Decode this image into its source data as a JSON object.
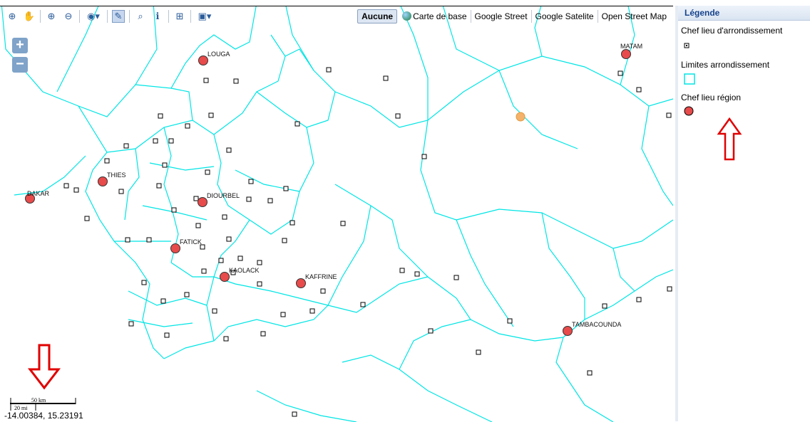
{
  "toolbar": {
    "tools": [
      {
        "icon": "zoom-extent-icon",
        "glyph": "⊕"
      },
      {
        "icon": "pan-hand-icon",
        "glyph": "✋"
      },
      {
        "icon": "zoom-in-icon",
        "glyph": "⊕"
      },
      {
        "icon": "zoom-out-icon",
        "glyph": "⊖"
      },
      {
        "icon": "navigation-history-icon",
        "glyph": "◉"
      },
      {
        "icon": "measure-ruler-icon",
        "glyph": "📏"
      },
      {
        "icon": "binoculars-icon",
        "glyph": "⌕"
      },
      {
        "icon": "info-icon",
        "glyph": "ℹ"
      },
      {
        "icon": "grid-select-icon",
        "glyph": "⊞"
      },
      {
        "icon": "save-menu-icon",
        "glyph": "▣"
      }
    ],
    "base_layers": [
      "Aucune",
      "Carte de base",
      "Google Street",
      "Google Satelite",
      "Open Street Map"
    ],
    "active_base_layer": "Aucune"
  },
  "zoom": {
    "plus": "+",
    "minus": "−"
  },
  "legend": {
    "title": "Légende",
    "items": [
      {
        "label": "Chef lieu d'arrondissement",
        "symbol": "small-square"
      },
      {
        "label": "Limites arrondissement",
        "symbol": "cyan-square"
      },
      {
        "label": "Chef lieu région",
        "symbol": "red-circle"
      }
    ]
  },
  "map": {
    "boundary_color": "#00e5e5",
    "region_color": "#e84b4b",
    "regions": [
      "LOUGA",
      "MATAM",
      "THIES",
      "DAKAR",
      "DIOURBEL",
      "FATICK",
      "KAOLACK",
      "KAFFRINE",
      "TAMBACOUNDA"
    ],
    "arrondissement_count": 62
  },
  "scale": {
    "km": "50 km",
    "mi": "20 mi"
  },
  "coordinates": "-14.00384, 15.23191",
  "annotations": {
    "arrow_color": "#e00000"
  }
}
